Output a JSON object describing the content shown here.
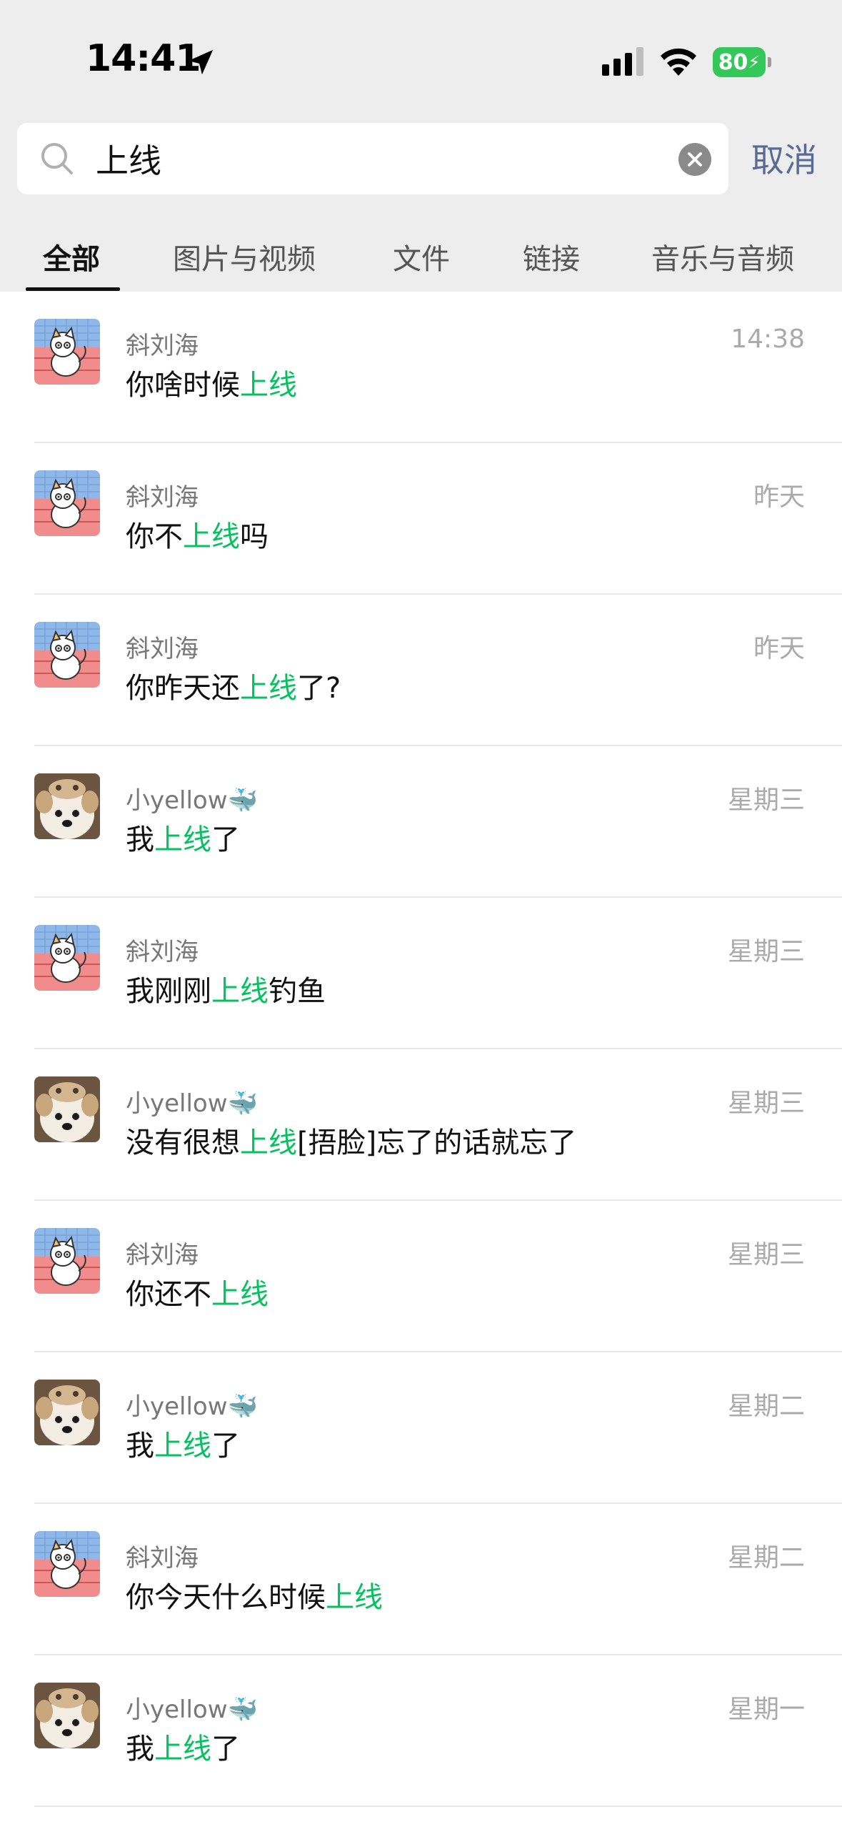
{
  "status_bar": {
    "time": "14:41",
    "battery": "80"
  },
  "search": {
    "query": "上线",
    "cancel_label": "取消"
  },
  "tabs": [
    "全部",
    "图片与视频",
    "文件",
    "链接",
    "音乐与音频"
  ],
  "accent_color": "#07c160",
  "results": [
    {
      "avatar": "cat-avatar",
      "name": "斜刘海",
      "whale": "",
      "date": "14:38",
      "pre": "你啥时候",
      "hl": "上线",
      "post": ""
    },
    {
      "avatar": "cat-avatar",
      "name": "斜刘海",
      "whale": "",
      "date": "昨天",
      "pre": "你不",
      "hl": "上线",
      "post": "吗"
    },
    {
      "avatar": "cat-avatar",
      "name": "斜刘海",
      "whale": "",
      "date": "昨天",
      "pre": "你昨天还",
      "hl": "上线",
      "post": "了?"
    },
    {
      "avatar": "dog-avatar",
      "name": "小yellow",
      "whale": "🐳",
      "date": "星期三",
      "pre": "我",
      "hl": "上线",
      "post": "了"
    },
    {
      "avatar": "cat-avatar",
      "name": "斜刘海",
      "whale": "",
      "date": "星期三",
      "pre": "我刚刚",
      "hl": "上线",
      "post": "钓鱼"
    },
    {
      "avatar": "dog-avatar",
      "name": "小yellow",
      "whale": "🐳",
      "date": "星期三",
      "pre": "没有很想",
      "hl": "上线",
      "post": "[捂脸]忘了的话就忘了"
    },
    {
      "avatar": "cat-avatar",
      "name": "斜刘海",
      "whale": "",
      "date": "星期三",
      "pre": "你还不",
      "hl": "上线",
      "post": ""
    },
    {
      "avatar": "dog-avatar",
      "name": "小yellow",
      "whale": "🐳",
      "date": "星期二",
      "pre": "我",
      "hl": "上线",
      "post": "了"
    },
    {
      "avatar": "cat-avatar",
      "name": "斜刘海",
      "whale": "",
      "date": "星期二",
      "pre": "你今天什么时候",
      "hl": "上线",
      "post": ""
    },
    {
      "avatar": "dog-avatar",
      "name": "小yellow",
      "whale": "🐳",
      "date": "星期一",
      "pre": "我",
      "hl": "上线",
      "post": "了"
    }
  ]
}
